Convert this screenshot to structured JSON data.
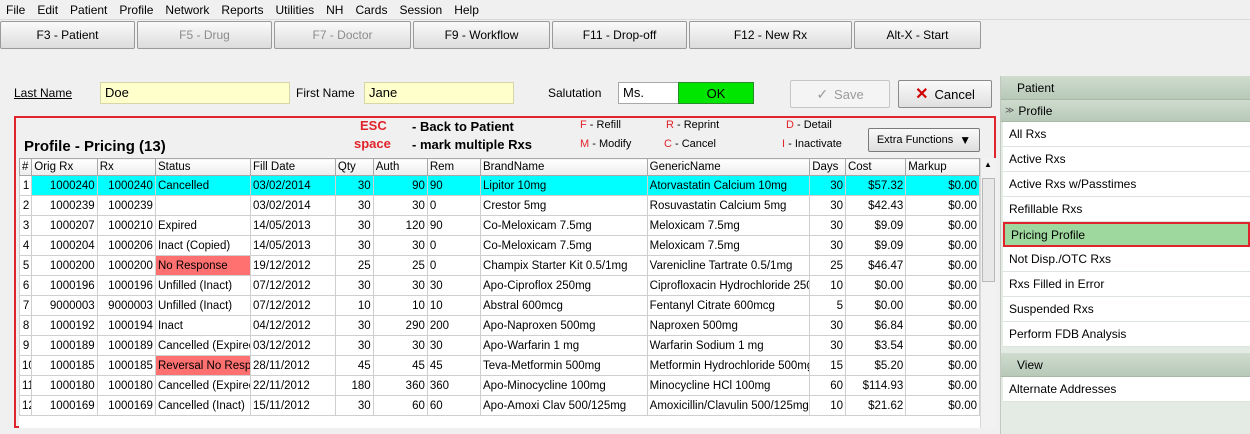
{
  "menu": {
    "items": [
      "File",
      "Edit",
      "Patient",
      "Profile",
      "Network",
      "Reports",
      "Utilities",
      "NH",
      "Cards",
      "Session",
      "Help"
    ]
  },
  "toolbar": {
    "buttons": [
      "F3 - Patient",
      "F5 - Drug",
      "F7 - Doctor",
      "F9 - Workflow",
      "F11 - Drop-off",
      "F12 - New Rx",
      "Alt-X - Start"
    ]
  },
  "header": {
    "last_name_label": "Last Name",
    "last_name_value": "Doe",
    "first_name_label": "First Name",
    "first_name_value": "Jane",
    "salutation_label": "Salutation",
    "salutation_value": "Ms.",
    "ok_label": "OK",
    "save_label": "Save",
    "cancel_label": "Cancel"
  },
  "profile": {
    "title": "Profile - Pricing (13)",
    "esc": "ESC",
    "esc_text": "- Back to Patient",
    "space": "space",
    "space_text": "- mark multiple Rxs",
    "legend": {
      "f": "F",
      "refill": " - Refill",
      "m": "M",
      "modify": " - Modify",
      "r": "R",
      "reprint": " - Reprint",
      "c": "C",
      "cancel": " - Cancel",
      "d": "D",
      "detail": " - Detail",
      "i": "I",
      "inactivate": " - Inactivate"
    },
    "extra_functions": "Extra Functions"
  },
  "table": {
    "headers": [
      "#",
      "Orig Rx",
      "Rx",
      "Status",
      "Fill Date",
      "Qty",
      "Auth",
      "Rem",
      "BrandName",
      "GenericName",
      "Days",
      "Cost",
      "Markup"
    ],
    "rows": [
      [
        "1",
        "1000240",
        "1000240",
        "Cancelled",
        "03/02/2014",
        "30",
        "90",
        "90",
        "Lipitor 10mg",
        "Atorvastatin Calcium 10mg",
        "30",
        "$57.32",
        "$0.00"
      ],
      [
        "2",
        "1000239",
        "1000239",
        "",
        "03/02/2014",
        "30",
        "30",
        "0",
        "Crestor 5mg",
        "Rosuvastatin Calcium 5mg",
        "30",
        "$42.43",
        "$0.00"
      ],
      [
        "3",
        "1000207",
        "1000210",
        "Expired",
        "14/05/2013",
        "30",
        "120",
        "90",
        "Co-Meloxicam 7.5mg",
        "Meloxicam 7.5mg",
        "30",
        "$9.09",
        "$0.00"
      ],
      [
        "4",
        "1000204",
        "1000206",
        "Inact (Copied)",
        "14/05/2013",
        "30",
        "30",
        "0",
        "Co-Meloxicam 7.5mg",
        "Meloxicam 7.5mg",
        "30",
        "$9.09",
        "$0.00"
      ],
      [
        "5",
        "1000200",
        "1000200",
        "No Response",
        "19/12/2012",
        "25",
        "25",
        "0",
        "Champix Starter Kit 0.5/1mg",
        "Varenicline Tartrate 0.5/1mg",
        "25",
        "$46.47",
        "$0.00"
      ],
      [
        "6",
        "1000196",
        "1000196",
        "Unfilled (Inact)",
        "07/12/2012",
        "30",
        "30",
        "30",
        "Apo-Ciproflox 250mg",
        "Ciprofloxacin Hydrochloride 250mg",
        "10",
        "$0.00",
        "$0.00"
      ],
      [
        "7",
        "9000003",
        "9000003",
        "Unfilled (Inact)",
        "07/12/2012",
        "10",
        "10",
        "10",
        "Abstral 600mcg",
        "Fentanyl Citrate 600mcg",
        "5",
        "$0.00",
        "$0.00"
      ],
      [
        "8",
        "1000192",
        "1000194",
        "Inact",
        "04/12/2012",
        "30",
        "290",
        "200",
        "Apo-Naproxen 500mg",
        "Naproxen 500mg",
        "30",
        "$6.84",
        "$0.00"
      ],
      [
        "9",
        "1000189",
        "1000189",
        "Cancelled (Expired)",
        "03/12/2012",
        "30",
        "30",
        "30",
        "Apo-Warfarin 1 mg",
        "Warfarin Sodium 1 mg",
        "30",
        "$3.54",
        "$0.00"
      ],
      [
        "10",
        "1000185",
        "1000185",
        "Reversal No Response",
        "28/11/2012",
        "45",
        "45",
        "45",
        "Teva-Metformin 500mg",
        "Metformin Hydrochloride 500mg",
        "15",
        "$5.20",
        "$0.00"
      ],
      [
        "11",
        "1000180",
        "1000180",
        "Cancelled (Expired)",
        "22/11/2012",
        "180",
        "360",
        "360",
        "Apo-Minocycline 100mg",
        "Minocycline HCl 100mg",
        "60",
        "$114.93",
        "$0.00"
      ],
      [
        "12",
        "1000169",
        "1000169",
        "Cancelled (Inact)",
        "15/11/2012",
        "30",
        "60",
        "60",
        "Apo-Amoxi Clav 500/125mg",
        "Amoxicillin/Clavulin 500/125mg",
        "10",
        "$21.62",
        "$0.00"
      ]
    ]
  },
  "sidebar": {
    "patient_header": "Patient",
    "profile_header": "Profile",
    "items": [
      "All Rxs",
      "Active Rxs",
      "Active Rxs w/Passtimes",
      "Refillable Rxs",
      "Pricing Profile",
      "Not Disp./OTC Rxs",
      "Rxs Filled in Error",
      "Suspended Rxs",
      "Perform FDB Analysis"
    ],
    "view_header": "View",
    "view_items": [
      "Alternate Addresses"
    ]
  },
  "colors": {
    "selected_row": "#00ffff",
    "alert_cell": "#ff7070",
    "ok_button": "#00e600",
    "highlight_border": "#e0242c",
    "active_item": "#9fd89f"
  }
}
